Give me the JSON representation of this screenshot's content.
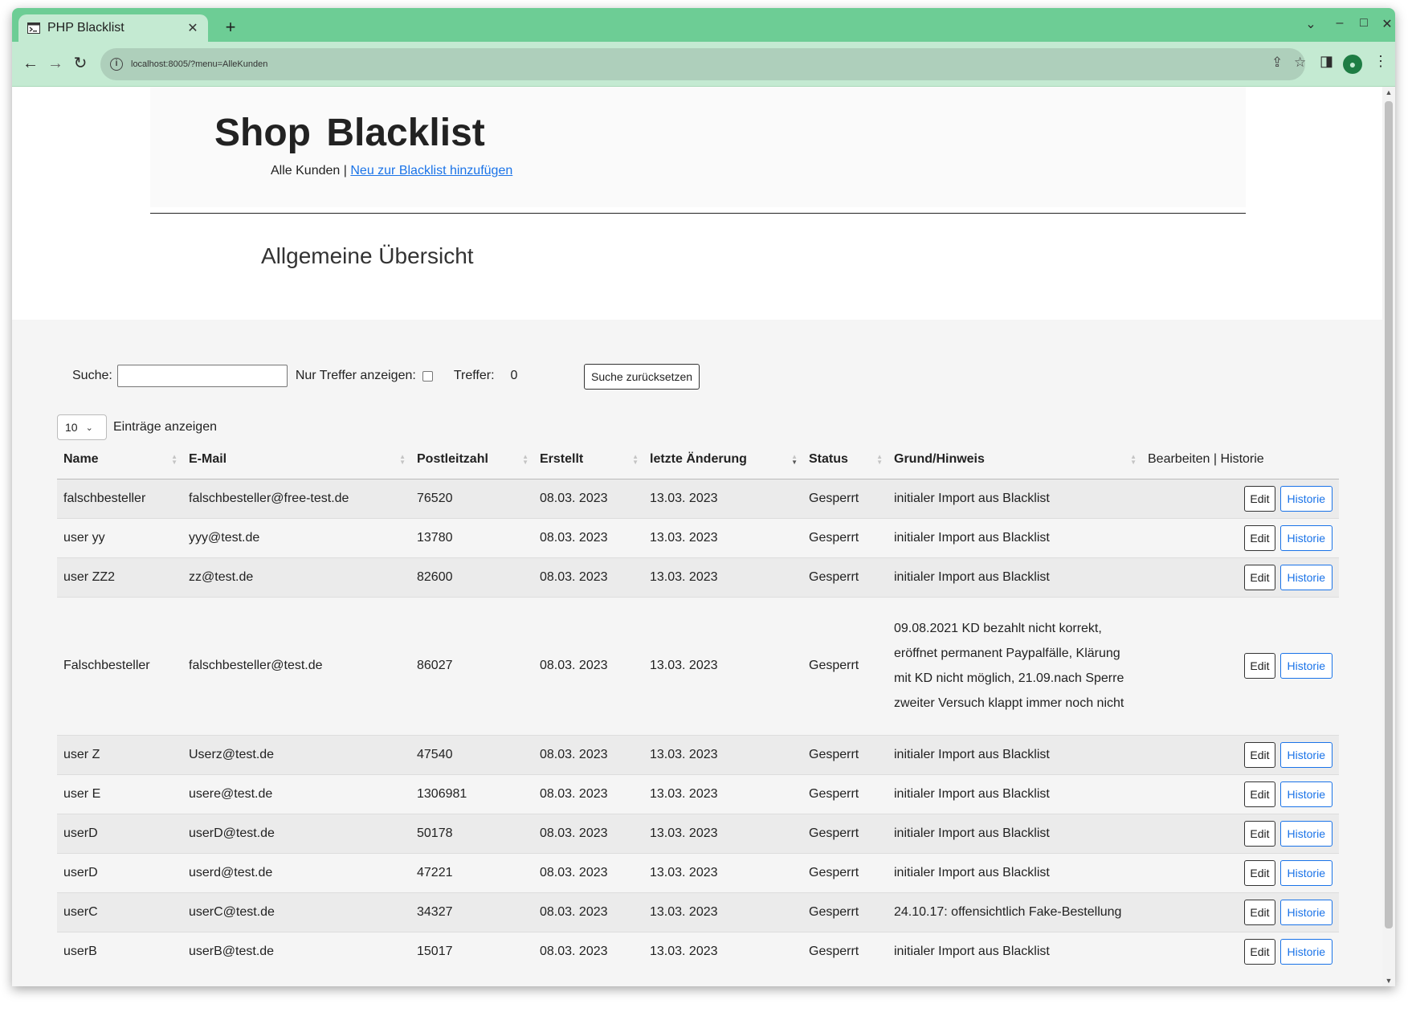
{
  "browser": {
    "tab_title": "PHP  Blacklist",
    "url": "localhost:8005/?menu=AlleKunden"
  },
  "site": {
    "title": "Shop  Blacklist",
    "nav_current": "Alle  Kunden",
    "nav_separator": "|",
    "nav_link": "Neu  zur  Blacklist  hinzufügen"
  },
  "page_heading": "Allgemeine Übersicht",
  "filters": {
    "search_label": "Suche:",
    "only_hits_label": "Nur  Treffer  anzeigen:",
    "hits_label": "Treffer:",
    "hits_value": "0",
    "reset_button": "Suche  zurücksetzen",
    "page_length": "10",
    "page_length_label": "Einträge  anzeigen"
  },
  "table": {
    "columns": [
      "Name",
      "E-Mail",
      "Postleitzahl",
      "Erstellt",
      "letzte  Änderung",
      "Status",
      "Grund/Hinweis"
    ],
    "actions_header": {
      "edit": "Bearbeiten",
      "separator": "|",
      "history": "Historie"
    },
    "edit_label": "Edit",
    "history_label": "Historie",
    "rows": [
      {
        "name": "falschbesteller",
        "email": "falschbesteller@free-test.de",
        "plz": "76520",
        "created": "08.03.  2023",
        "changed": "13.03.  2023",
        "status": "Gesperrt",
        "note": "initialer  Import  aus  Blacklist"
      },
      {
        "name": "user  yy",
        "email": "yyy@test.de",
        "plz": "13780",
        "created": "08.03.  2023",
        "changed": "13.03.  2023",
        "status": "Gesperrt",
        "note": "initialer  Import  aus  Blacklist"
      },
      {
        "name": "user  ZZ2",
        "email": "zz@test.de",
        "plz": "82600",
        "created": "08.03.  2023",
        "changed": "13.03.  2023",
        "status": "Gesperrt",
        "note": "initialer  Import  aus  Blacklist"
      },
      {
        "name": "Falschbesteller",
        "email": "falschbesteller@test.de",
        "plz": "86027",
        "created": "08.03.  2023",
        "changed": "13.03.  2023",
        "status": "Gesperrt",
        "note": "09.08.2021  KD  bezahlt  nicht  korrekt,  eröffnet  permanent  Paypalfälle,  Klärung  mit  KD  nicht  möglich,  21.09.nach  Sperre  zweiter  Versuch  klappt  immer  noch  nicht"
      },
      {
        "name": "user  Z",
        "email": "Userz@test.de",
        "plz": "47540",
        "created": "08.03.  2023",
        "changed": "13.03.  2023",
        "status": "Gesperrt",
        "note": "initialer  Import  aus  Blacklist"
      },
      {
        "name": "user  E",
        "email": "usere@test.de",
        "plz": "1306981",
        "created": "08.03.  2023",
        "changed": "13.03.  2023",
        "status": "Gesperrt",
        "note": "initialer  Import  aus  Blacklist"
      },
      {
        "name": "userD",
        "email": "userD@test.de",
        "plz": "50178",
        "created": "08.03.  2023",
        "changed": "13.03.  2023",
        "status": "Gesperrt",
        "note": "initialer  Import  aus  Blacklist"
      },
      {
        "name": "userD",
        "email": "userd@test.de",
        "plz": "47221",
        "created": "08.03.  2023",
        "changed": "13.03.  2023",
        "status": "Gesperrt",
        "note": "initialer  Import  aus  Blacklist"
      },
      {
        "name": "userC",
        "email": "userC@test.de",
        "plz": "34327",
        "created": "08.03.  2023",
        "changed": "13.03.  2023",
        "status": "Gesperrt",
        "note": "24.10.17:  offensichtlich  Fake-Bestellung"
      },
      {
        "name": "userB",
        "email": "userB@test.de",
        "plz": "15017",
        "created": "08.03.  2023",
        "changed": "13.03.  2023",
        "status": "Gesperrt",
        "note": "initialer  Import  aus  Blacklist"
      }
    ]
  }
}
